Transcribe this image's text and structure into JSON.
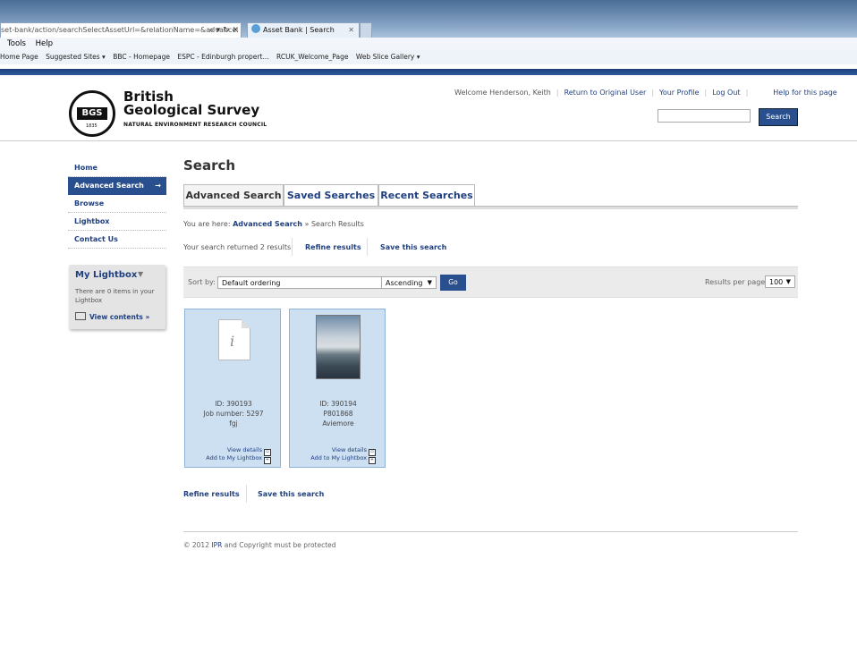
{
  "browser": {
    "address_text": "set-bank/action/searchSelectAssetUrl=&relationName=&advance:",
    "address_controls": "⌕ ▾ ↻ ✕",
    "tab_title": "Asset Bank | Search Results",
    "tab_close": "✕",
    "menu": [
      "Tools",
      "Help"
    ],
    "favorites": [
      "Home Page",
      "Suggested Sites ▾",
      "BBC - Homepage",
      "ESPC - Edinburgh propert...",
      "RCUK_Welcome_Page",
      "Web Slice Gallery ▾"
    ]
  },
  "header": {
    "logo_badge": "BGS",
    "logo_year": "1835",
    "logo_line1": "British",
    "logo_line2": "Geological Survey",
    "logo_line3": "NATURAL ENVIRONMENT RESEARCH COUNCIL",
    "welcome": "Welcome Henderson, Keith",
    "links": [
      "Return to Original User",
      "Your Profile",
      "Log Out"
    ],
    "help": "Help for this page",
    "search_button": "Search"
  },
  "nav": {
    "items": [
      "Home",
      "Advanced Search",
      "Browse",
      "Lightbox",
      "Contact Us"
    ],
    "active_arrow": "→"
  },
  "lightbox": {
    "title": "My Lightbox",
    "dropdown": "▼",
    "text": "There are 0 items in your Lightbox",
    "view": "View contents »"
  },
  "main": {
    "title": "Search",
    "tabs": [
      "Advanced Search",
      "Saved Searches",
      "Recent Searches"
    ],
    "crumb_prefix": "You are here:",
    "crumb_link": "Advanced Search",
    "crumb_suffix": "» Search Results",
    "summary": "Your search returned 2 results",
    "refine": "Refine results",
    "save": "Save this search"
  },
  "sort": {
    "label": "Sort by:",
    "ordering": "Default ordering",
    "direction": "Ascending",
    "go": "Go",
    "rpp_label": "Results per page:",
    "rpp_value": "100"
  },
  "results": [
    {
      "id": "ID: 390193",
      "line2": "Job number: 5297",
      "line3": "fgj",
      "view": "View details",
      "add": "Add to My Lightbox",
      "thumb": "document-placeholder"
    },
    {
      "id": "ID: 390194",
      "line2": "P801868",
      "line3": "Aviemore",
      "view": "View details",
      "add": "Add to My Lightbox",
      "thumb": "photo"
    }
  ],
  "footer": {
    "prefix": "© 2012",
    "ipr": "IPR",
    "suffix": "and Copyright must be protected"
  }
}
